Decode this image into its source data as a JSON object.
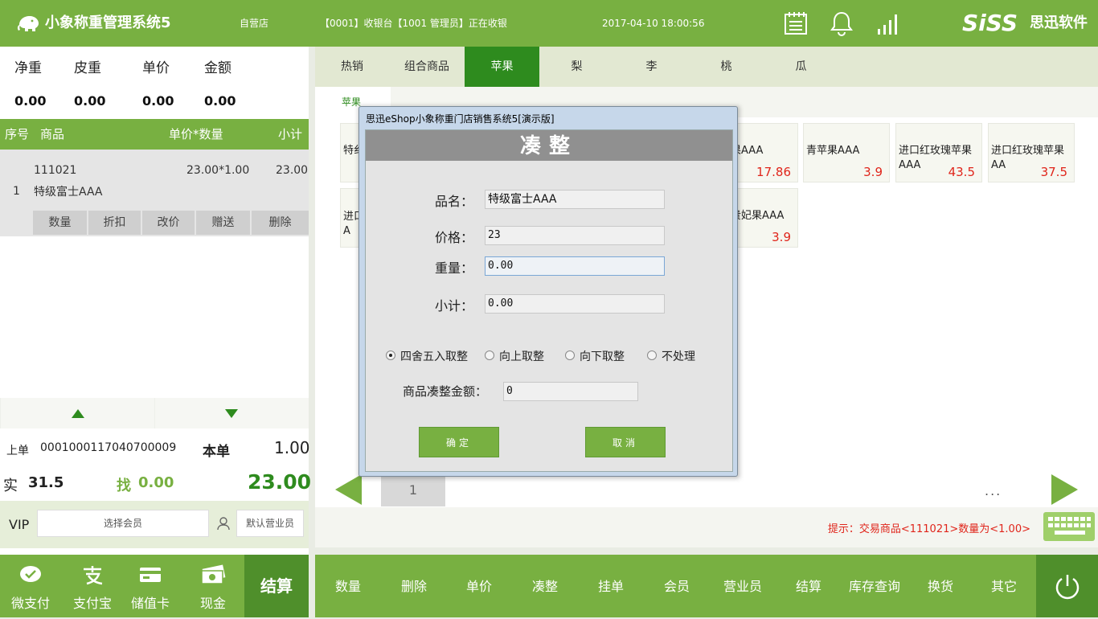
{
  "header": {
    "app_title": "小象称重管理系统5",
    "store": "自营店",
    "status": "【0001】收银台【1001 管理员】正在收银",
    "datetime": "2017-04-10 18:00:56",
    "brand": "SiSS",
    "brand_sub": "思迅软件",
    "icons": [
      "notepad-icon",
      "bell-icon",
      "signal-icon",
      "elephant-logo-icon"
    ]
  },
  "weights": {
    "labels": [
      "净重",
      "皮重",
      "单价",
      "金额"
    ],
    "values": [
      "0.00",
      "0.00",
      "0.00",
      "0.00"
    ]
  },
  "table": {
    "headers": [
      "序号",
      "商品",
      "单价*数量",
      "小计"
    ],
    "rows": [
      {
        "index": "1",
        "code": "111021",
        "name": "特级富士AAA",
        "price_qty": "23.00*1.00",
        "subtotal": "23.00"
      }
    ],
    "actions": [
      "数量",
      "折扣",
      "改价",
      "赠送",
      "删除"
    ]
  },
  "summary": {
    "last_label": "上单",
    "last_no": "0001000117040700009",
    "this_label": "本单",
    "this_value": "1.00",
    "paid_label": "实",
    "paid_value": "31.5",
    "change_label": "找",
    "change_value": "0.00",
    "total": "23.00"
  },
  "vip": {
    "label": "VIP",
    "member_placeholder": "选择会员",
    "clerk_placeholder": "默认营业员"
  },
  "payments": [
    {
      "label": "微支付",
      "icon": "wechat-pay-icon"
    },
    {
      "label": "支付宝",
      "icon": "alipay-icon"
    },
    {
      "label": "储值卡",
      "icon": "stored-card-icon"
    },
    {
      "label": "现金",
      "icon": "cash-icon"
    }
  ],
  "settle_label": "结算",
  "categories": [
    "热销",
    "组合商品",
    "苹果",
    "梨",
    "李",
    "桃",
    "瓜"
  ],
  "active_category": "苹果",
  "subcategory": "苹果",
  "products": [
    {
      "name": "特级富士AAA",
      "visible_name": "特纟",
      "price": ""
    },
    {
      "name": "果AAA",
      "price": "17.86"
    },
    {
      "name": "青苹果AAA",
      "price": "3.9"
    },
    {
      "name": "进口红玫瑰苹果AAA",
      "price": "43.5"
    },
    {
      "name": "进口红玫瑰苹果AA",
      "price": "37.5"
    },
    {
      "name": "进口",
      "visible_name": "进口\nA",
      "price": ""
    },
    {
      "name": "贵妃果AAA",
      "price": "3.9"
    }
  ],
  "pager": {
    "page": "1",
    "more": "..."
  },
  "hint": "提示：交易商品<111021>数量为<1.00>",
  "toolbar": [
    "数量",
    "删除",
    "单价",
    "凑整",
    "挂单",
    "会员",
    "营业员",
    "结算",
    "库存查询",
    "换货",
    "其它"
  ],
  "dialog": {
    "window_title": "思迅eShop小象称重门店销售系统5[演示版]",
    "heading": "凑整",
    "name_label": "品名：",
    "name_value": "特级富士AAA",
    "price_label": "价格：",
    "price_value": "23",
    "weight_label": "重量：",
    "weight_value": "0.00",
    "subtotal_label": "小计：",
    "subtotal_value": "0.00",
    "rounding_options": [
      "四舍五入取整",
      "向上取整",
      "向下取整",
      "不处理"
    ],
    "selected_option": "四舍五入取整",
    "round_amount_label": "商品凑整金额：",
    "round_amount_value": "0",
    "ok": "确定",
    "cancel": "取消"
  },
  "colors": {
    "primary": "#78b041",
    "dark": "#2e8b1e",
    "accent_red": "#e0251b"
  }
}
